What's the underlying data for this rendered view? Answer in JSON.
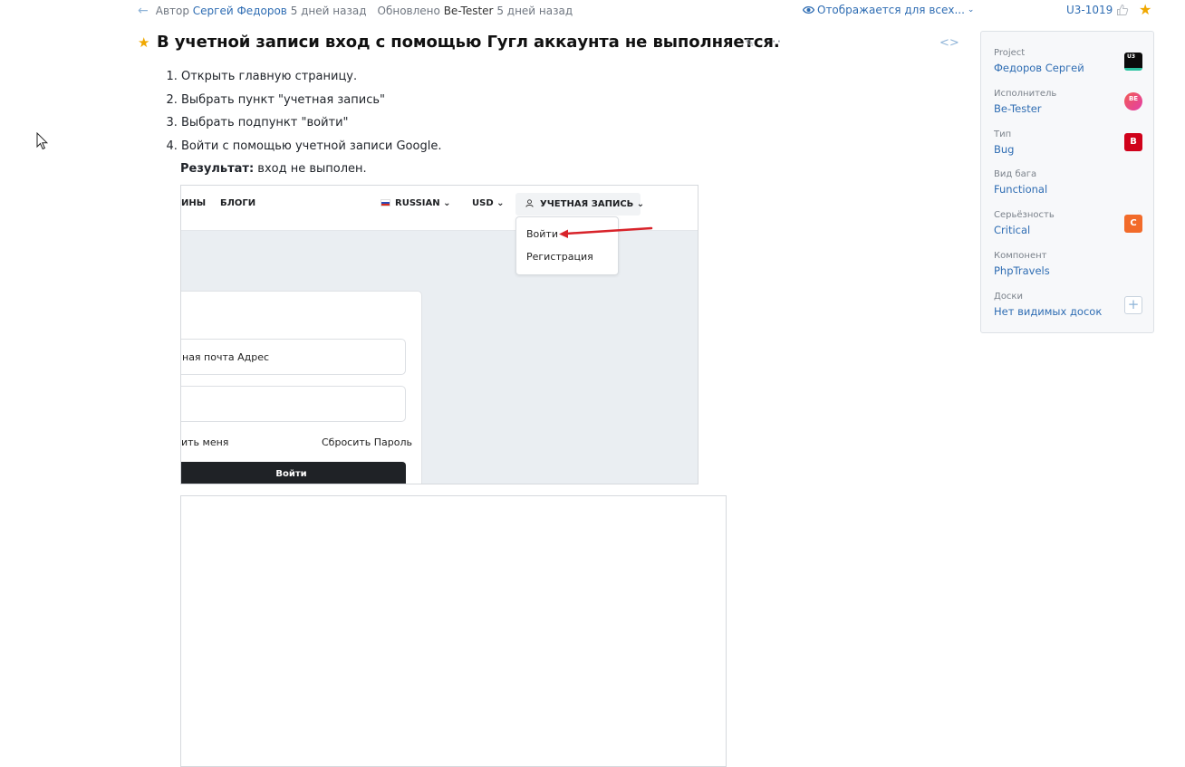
{
  "header": {
    "author_label": "Автор",
    "author_name": "Сергей Федоров",
    "created_ago": "5 дней назад",
    "updated_label": "Обновлено",
    "updated_by": "Be-Tester",
    "updated_ago": "5 дней назад",
    "visibility": "Отображается для всех...",
    "issue_id": "U3-1019"
  },
  "issue": {
    "title": "В учетной записи вход с помощью Гугл аккаунта не выполняется.",
    "steps": [
      "Открыть главную страницу.",
      "Выбрать пункт \"учетная запись\"",
      "Выбрать подпункт \"войти\"",
      "Войти с помощью учетной записи Google."
    ],
    "result_label": "Результат:",
    "result_text": "вход не выполен."
  },
  "screenshot": {
    "nav_partial": "ИНЫ",
    "nav_blogs": "БЛОГИ",
    "lang": "RUSSIAN",
    "currency": "USD",
    "account": "УЧЕТНАЯ ЗАПИСЬ",
    "menu_login": "Войти",
    "menu_register": "Регистрация",
    "email_field": "ная почта Адрес",
    "remember": "ить меня",
    "reset_password": "Сбросить Пароль",
    "login_button": "Войти"
  },
  "properties": [
    {
      "label": "Project",
      "value": "Федоров Сергей",
      "badge": "U3"
    },
    {
      "label": "Исполнитель",
      "value": "Be-Tester",
      "badge": "BE"
    },
    {
      "label": "Тип",
      "value": "Bug",
      "badge": "B"
    },
    {
      "label": "Вид бага",
      "value": "Functional",
      "badge": ""
    },
    {
      "label": "Серьёзность",
      "value": "Critical",
      "badge": "C"
    },
    {
      "label": "Компонент",
      "value": "PhpTravels",
      "badge": ""
    },
    {
      "label": "Доски",
      "value": "Нет видимых досок",
      "badge": "+"
    }
  ],
  "colors": {
    "accent": "#2f6db3",
    "star": "#f0a800",
    "bug": "#d0021b",
    "critical": "#f26b2a"
  }
}
